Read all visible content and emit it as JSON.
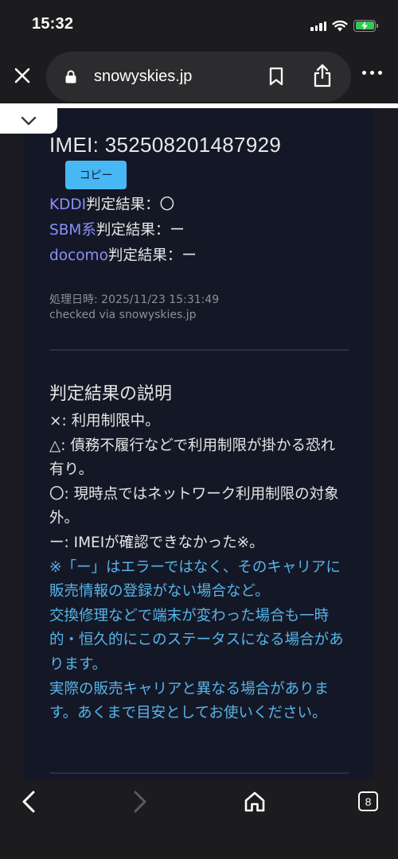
{
  "status_bar": {
    "time": "15:32",
    "icons": [
      "signal-icon",
      "wifi-icon",
      "battery-charging-icon"
    ]
  },
  "browser": {
    "url": "snowyskies.jp",
    "buttons": [
      "close-icon",
      "lock-icon",
      "bookmark-icon",
      "share-icon",
      "more-icon"
    ],
    "tab_count": "8"
  },
  "page": {
    "imei_label": "IMEI: 352508201487929",
    "copy_button": "コピー",
    "results": [
      {
        "carrier": "KDDI",
        "suffix": "判定結果：〇"
      },
      {
        "carrier": "SBM系",
        "suffix": "判定結果：ー"
      },
      {
        "carrier": "docomo",
        "suffix": "判定結果：ー"
      }
    ],
    "processed_at": "処理日時: 2025/11/23 15:31:49",
    "checked_via": "checked via snowyskies.jp",
    "explanation_heading": "判定結果の説明",
    "legend": [
      "×: 利用制限中。",
      "△: 債務不履行などで利用制限が掛かる恐れ有り。",
      "〇: 現時点ではネットワーク利用制限の対象外。",
      "ー: IMEIが確認できなかった※。"
    ],
    "notes": [
      "※「ー」はエラーではなく、そのキャリアに販売情報の登録がない場合など。",
      "交換修理などで端末が変わった場合も一時的・恒久的にこのステータスになる場合があります。",
      "実際の販売キャリアと異なる場合があります。あくまで目安としてお使いください。"
    ]
  },
  "colors": {
    "link": "#8b8ff8",
    "note": "#57b4ea",
    "copy_button": "#48b8f5",
    "battery": "#34c759",
    "panel_bg": "#141826"
  }
}
